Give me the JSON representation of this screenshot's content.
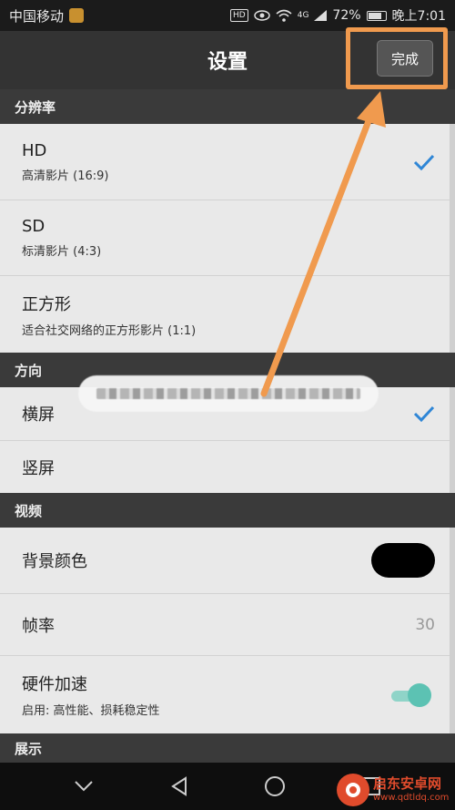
{
  "status_bar": {
    "carrier": "中国移动",
    "hd": "HD",
    "network": "4G",
    "battery": "72%",
    "time": "晚上7:01"
  },
  "toolbar": {
    "title": "设置",
    "done_label": "完成"
  },
  "sections": {
    "resolution": {
      "header": "分辨率",
      "items": [
        {
          "label": "HD",
          "sub": "高清影片 (16:9)",
          "checked": true
        },
        {
          "label": "SD",
          "sub": "标清影片 (4:3)",
          "checked": false
        },
        {
          "label": "正方形",
          "sub": "适合社交网络的正方形影片 (1:1)",
          "checked": false
        }
      ]
    },
    "orientation": {
      "header": "方向",
      "items": [
        {
          "label": "横屏",
          "checked": true
        },
        {
          "label": "竖屏",
          "checked": false
        }
      ]
    },
    "video": {
      "header": "视频",
      "background_color": {
        "label": "背景颜色",
        "value_color": "#000000"
      },
      "frame_rate": {
        "label": "帧率",
        "value": "30"
      },
      "hw_accel": {
        "label": "硬件加速",
        "sub": "启用: 高性能、损耗稳定性",
        "enabled": true
      }
    },
    "display": {
      "header": "展示"
    }
  },
  "watermark": {
    "name": "启东安卓网",
    "url": "www.qdtldq.com"
  },
  "colors": {
    "accent": "#2f86d6",
    "highlight": "#f09a4e",
    "toggle": "#5cc2b3"
  }
}
